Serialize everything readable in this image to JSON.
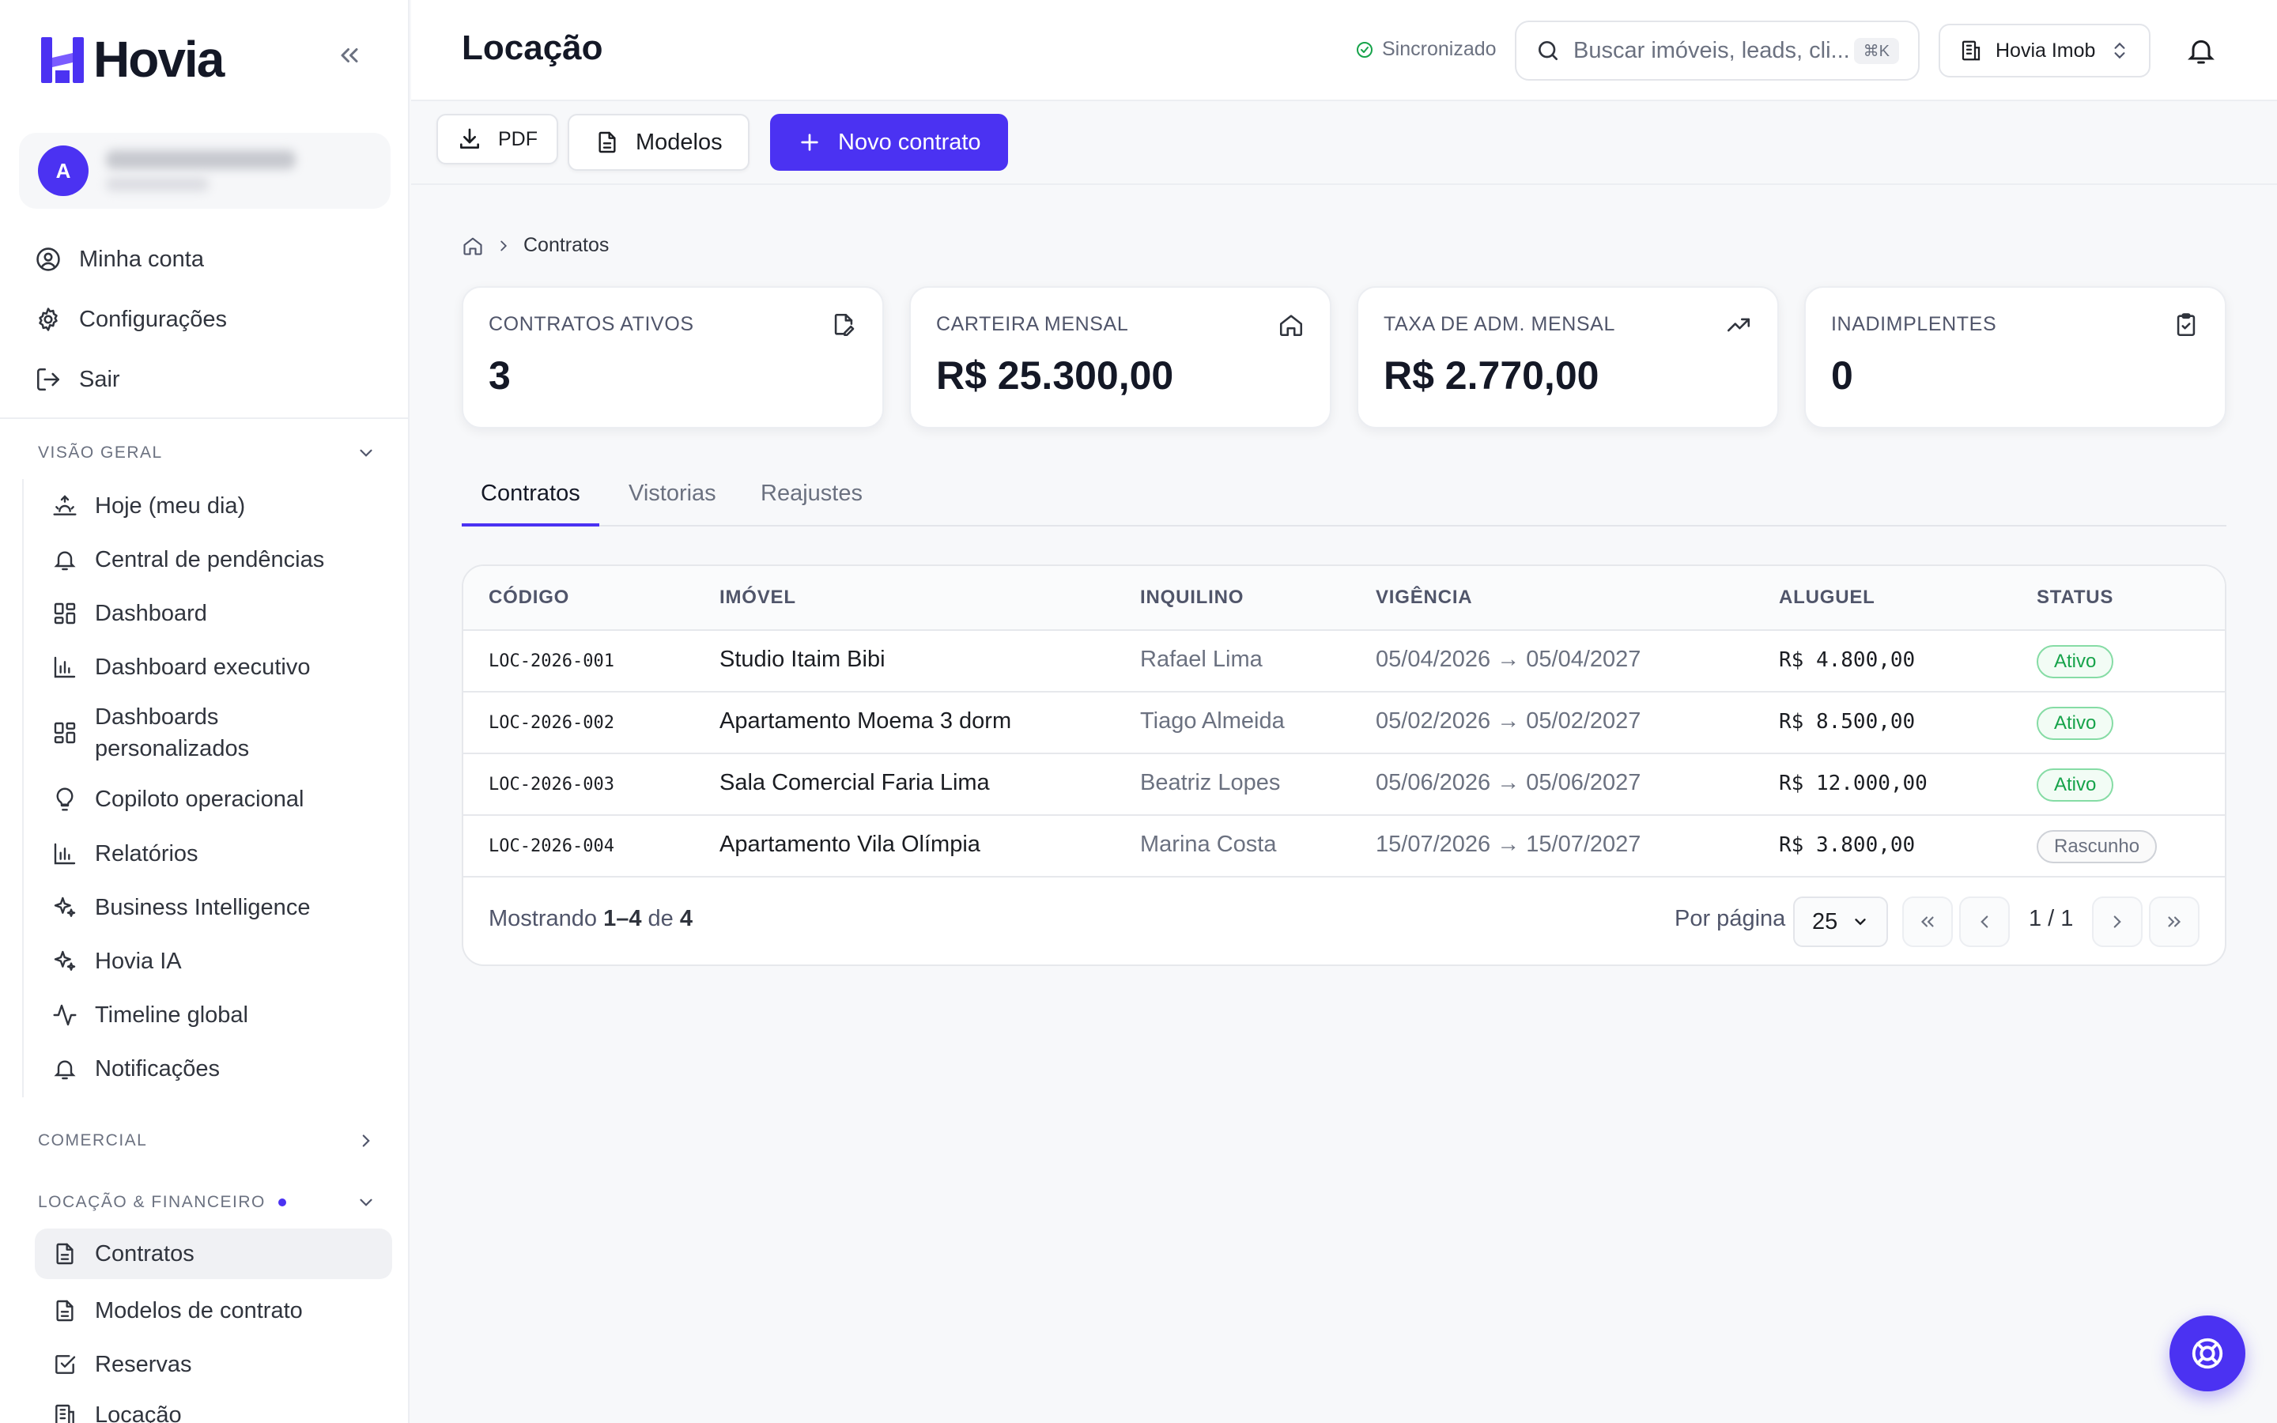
{
  "brand": {
    "name": "Hovia",
    "color": "#4b32f2"
  },
  "sidebar": {
    "user": {
      "initial": "A"
    },
    "account_items": [
      {
        "label": "Minha conta",
        "icon": "user-circle-icon"
      },
      {
        "label": "Configurações",
        "icon": "gear-icon"
      },
      {
        "label": "Sair",
        "icon": "logout-icon"
      }
    ],
    "sections": {
      "overview": {
        "title": "VISÃO GERAL",
        "expanded": true,
        "items": [
          {
            "label": "Hoje (meu dia)",
            "icon": "sunrise-icon"
          },
          {
            "label": "Central de pendências",
            "icon": "bell-icon"
          },
          {
            "label": "Dashboard",
            "icon": "grid-icon"
          },
          {
            "label": "Dashboard executivo",
            "icon": "bar-chart-icon"
          },
          {
            "label": "Dashboards personalizados",
            "icon": "grid-icon"
          },
          {
            "label": "Copiloto operacional",
            "icon": "lightbulb-icon"
          },
          {
            "label": "Relatórios",
            "icon": "bar-chart-icon"
          },
          {
            "label": "Business Intelligence",
            "icon": "sparkles-icon"
          },
          {
            "label": "Hovia IA",
            "icon": "sparkles-icon"
          },
          {
            "label": "Timeline global",
            "icon": "activity-icon"
          },
          {
            "label": "Notificações",
            "icon": "bell-icon"
          }
        ]
      },
      "commercial": {
        "title": "COMERCIAL",
        "expanded": false
      },
      "rental": {
        "title": "LOCAÇÃO & FINANCEIRO",
        "expanded": true,
        "items": [
          {
            "label": "Contratos",
            "icon": "document-icon",
            "active": true
          },
          {
            "label": "Modelos de contrato",
            "icon": "document-icon"
          },
          {
            "label": "Reservas",
            "icon": "checkbox-icon"
          },
          {
            "label": "Locação",
            "icon": "building-icon"
          }
        ]
      }
    }
  },
  "header": {
    "title": "Locação",
    "sync_status": "Sincronizado",
    "search_placeholder": "Buscar imóveis, leads, cli...",
    "search_shortcut": "⌘K",
    "org_name": "Hovia Imob"
  },
  "toolbar": {
    "pdf_label": "PDF",
    "templates_label": "Modelos",
    "new_contract_label": "Novo contrato"
  },
  "breadcrumb": {
    "current": "Contratos"
  },
  "stats": [
    {
      "label": "CONTRATOS ATIVOS",
      "value": "3",
      "icon": "edit-document-icon"
    },
    {
      "label": "CARTEIRA MENSAL",
      "value": "R$ 25.300,00",
      "icon": "home-icon"
    },
    {
      "label": "TAXA DE ADM. MENSAL",
      "value": "R$ 2.770,00",
      "icon": "trending-up-icon"
    },
    {
      "label": "INADIMPLENTES",
      "value": "0",
      "icon": "clipboard-check-icon"
    }
  ],
  "tabs": [
    {
      "label": "Contratos",
      "active": true
    },
    {
      "label": "Vistorias",
      "active": false
    },
    {
      "label": "Reajustes",
      "active": false
    }
  ],
  "table": {
    "columns": [
      "CÓDIGO",
      "IMÓVEL",
      "INQUILINO",
      "VIGÊNCIA",
      "ALUGUEL",
      "STATUS"
    ],
    "rows": [
      {
        "code": "LOC-2026-001",
        "property": "Studio Itaim Bibi",
        "tenant": "Rafael Lima",
        "period": "05/04/2026 → 05/04/2027",
        "rent": "R$ 4.800,00",
        "status": "Ativo"
      },
      {
        "code": "LOC-2026-002",
        "property": "Apartamento Moema 3 dorm",
        "tenant": "Tiago Almeida",
        "period": "05/02/2026 → 05/02/2027",
        "rent": "R$ 8.500,00",
        "status": "Ativo"
      },
      {
        "code": "LOC-2026-003",
        "property": "Sala Comercial Faria Lima",
        "tenant": "Beatriz Lopes",
        "period": "05/06/2026 → 05/06/2027",
        "rent": "R$ 12.000,00",
        "status": "Ativo"
      },
      {
        "code": "LOC-2026-004",
        "property": "Apartamento Vila Olímpia",
        "tenant": "Marina Costa",
        "period": "15/07/2026 → 15/07/2027",
        "rent": "R$ 3.800,00",
        "status": "Rascunho"
      }
    ],
    "footer": {
      "showing_prefix": "Mostrando",
      "range": "1–4",
      "of": "de",
      "total": "4",
      "per_page_label": "Por página",
      "per_page_value": "25",
      "page_info": "1 / 1"
    }
  },
  "colors": {
    "accent": "#4b32f2",
    "active_status": "#16a34a",
    "draft_status": "#6b7180"
  }
}
